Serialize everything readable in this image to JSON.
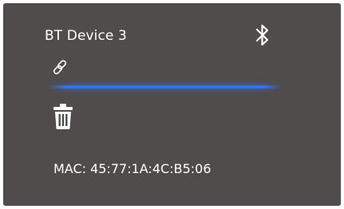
{
  "device": {
    "name": "BT Device 3",
    "mac": "MAC: 45:77:1A:4C:B5:06"
  },
  "icons": {
    "bluetooth": "bluetooth-icon",
    "link": "link-icon",
    "delete": "trash-icon"
  },
  "colors": {
    "card_background": "#4f4c4b",
    "text": "#ffffff",
    "accent_line": "#2f77e8"
  }
}
